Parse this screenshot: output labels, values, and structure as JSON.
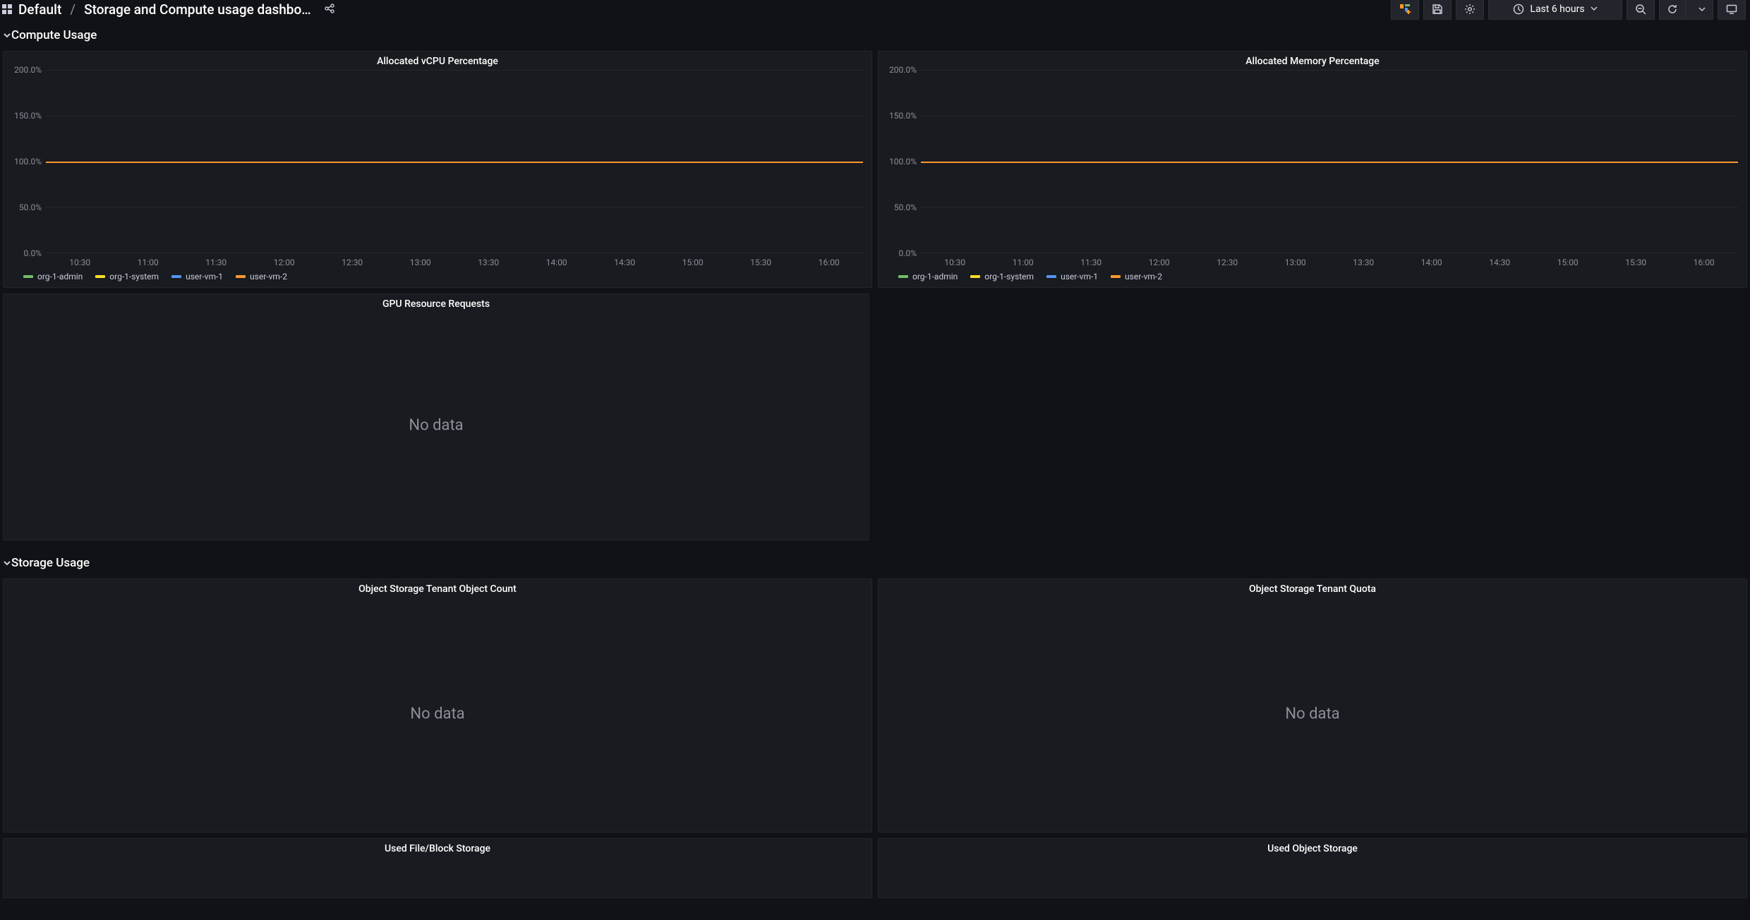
{
  "breadcrumb": {
    "grid_icon": "grid",
    "folder": "Default",
    "title": "Storage and Compute usage dashbo…"
  },
  "toolbar": {
    "add_panel": "add-panel",
    "save": "save",
    "settings": "settings",
    "time_range_label": "Last 6 hours",
    "zoom_out": "zoom-out",
    "refresh": "refresh",
    "tv": "tv"
  },
  "rows": {
    "compute": "Compute Usage",
    "storage": "Storage Usage"
  },
  "panels": {
    "vcpu": {
      "title": "Allocated vCPU Percentage"
    },
    "memory": {
      "title": "Allocated Memory Percentage"
    },
    "gpu": {
      "title": "GPU Resource Requests",
      "empty": "No data"
    },
    "obj_count": {
      "title": "Object Storage Tenant Object Count",
      "empty": "No data"
    },
    "obj_quota": {
      "title": "Object Storage Tenant Quota",
      "empty": "No data"
    },
    "file_block": {
      "title": "Used File/Block Storage"
    },
    "obj_storage": {
      "title": "Used Object Storage"
    }
  },
  "chart_data": [
    {
      "panel": "vcpu",
      "type": "line",
      "ylim": [
        0,
        200
      ],
      "yticks": [
        "0.0%",
        "50.0%",
        "100.0%",
        "150.0%",
        "200.0%"
      ],
      "x": [
        "10:30",
        "11:00",
        "11:30",
        "12:00",
        "12:30",
        "13:00",
        "13:30",
        "14:00",
        "14:30",
        "15:00",
        "15:30",
        "16:00"
      ],
      "series": [
        {
          "name": "org-1-admin",
          "color": "#73BF69",
          "value_constant": 100.0
        },
        {
          "name": "org-1-system",
          "color": "#FADE2A",
          "value_constant": 100.0
        },
        {
          "name": "user-vm-1",
          "color": "#5794F2",
          "value_constant": 100.0
        },
        {
          "name": "user-vm-2",
          "color": "#FF9830",
          "value_constant": 100.0
        }
      ]
    },
    {
      "panel": "memory",
      "type": "line",
      "ylim": [
        0,
        200
      ],
      "yticks": [
        "0.0%",
        "50.0%",
        "100.0%",
        "150.0%",
        "200.0%"
      ],
      "x": [
        "10:30",
        "11:00",
        "11:30",
        "12:00",
        "12:30",
        "13:00",
        "13:30",
        "14:00",
        "14:30",
        "15:00",
        "15:30",
        "16:00"
      ],
      "series": [
        {
          "name": "org-1-admin",
          "color": "#73BF69",
          "value_constant": 100.0
        },
        {
          "name": "org-1-system",
          "color": "#FADE2A",
          "value_constant": 100.0
        },
        {
          "name": "user-vm-1",
          "color": "#5794F2",
          "value_constant": 100.0
        },
        {
          "name": "user-vm-2",
          "color": "#FF9830",
          "value_constant": 100.0
        }
      ]
    }
  ]
}
